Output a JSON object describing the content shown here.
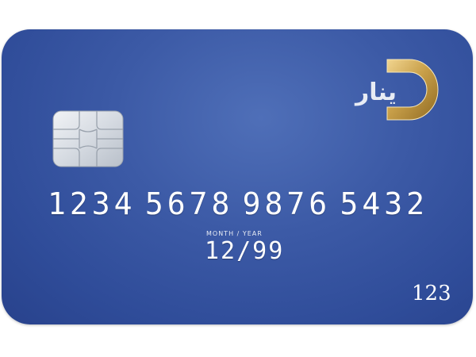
{
  "card": {
    "brand_text": "ينار",
    "number_groups": [
      "1234",
      "5678",
      "9876",
      "5432"
    ],
    "expiry_label": "MONTH / YEAR",
    "expiry_value": "12/99",
    "cvv": "123"
  },
  "colors": {
    "card_blue": "#3c5aa6",
    "text": "#ffffff",
    "logo_gold": "#c9a04a",
    "chip_silver": "#d8dde4"
  },
  "icons": {
    "chip": "emv-chip-icon",
    "logo": "dinar-d-logo"
  }
}
